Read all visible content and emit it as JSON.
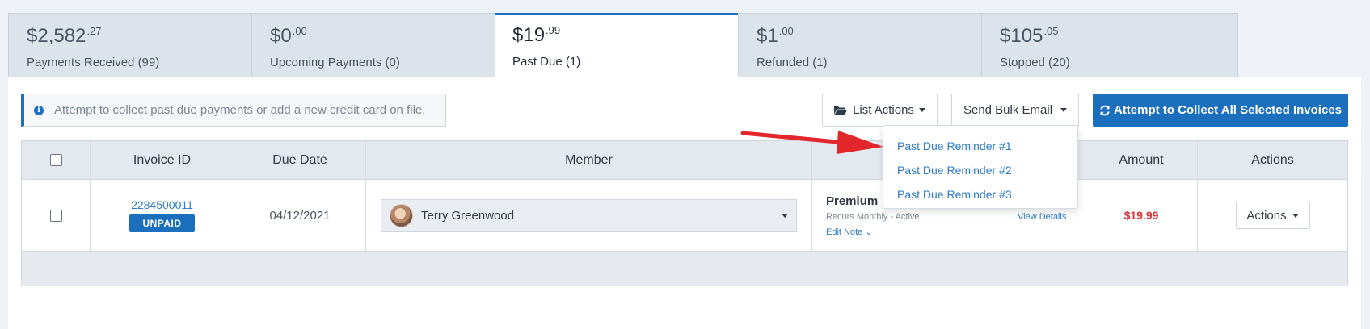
{
  "tabs": [
    {
      "amount": "$2,582",
      "cents": ".27",
      "label": "Payments Received (99)",
      "active": false
    },
    {
      "amount": "$0",
      "cents": ".00",
      "label": "Upcoming Payments (0)",
      "active": false
    },
    {
      "amount": "$19",
      "cents": ".99",
      "label": "Past Due (1)",
      "active": true
    },
    {
      "amount": "$1",
      "cents": ".00",
      "label": "Refunded (1)",
      "active": false
    },
    {
      "amount": "$105",
      "cents": ".05",
      "label": "Stopped (20)",
      "active": false
    }
  ],
  "info": {
    "icon": "info-icon",
    "text": "Attempt to collect past due payments or add a new credit card on file."
  },
  "toolbar": {
    "list_actions_label": "List Actions",
    "send_bulk_email_label": "Send Bulk Email",
    "collect_all_label": "Attempt to Collect All Selected Invoices"
  },
  "table": {
    "headers": {
      "invoice_id": "Invoice ID",
      "due_date": "Due Date",
      "member": "Member",
      "plan": "",
      "amount": "Amount",
      "actions": "Actions"
    },
    "rows": [
      {
        "invoice_id": "2284500011",
        "status": "UNPAID",
        "due_date": "04/12/2021",
        "member": "Terry Greenwood",
        "plan_name": "Premium",
        "plan_status": "Recurs Monthly - Active",
        "edit_note": "Edit Note",
        "view_details": "View Details",
        "amount": "$19.99",
        "actions_label": "Actions"
      }
    ]
  },
  "dropdown": {
    "items": [
      "Past Due Reminder #1",
      "Past Due Reminder #2",
      "Past Due Reminder #3"
    ]
  },
  "colors": {
    "accent": "#1c6fbd",
    "amount_red": "#d9393b",
    "annotation_arrow": "#e3262b"
  }
}
